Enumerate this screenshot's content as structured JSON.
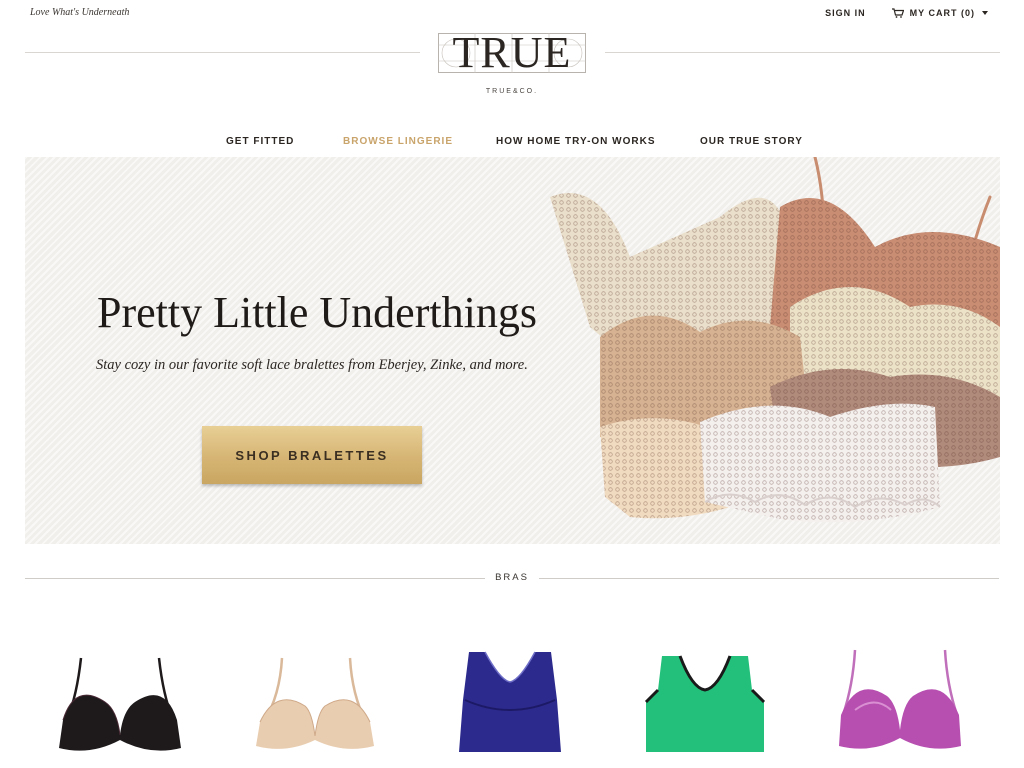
{
  "header": {
    "tagline": "Love What's Underneath",
    "sign_in": "SIGN IN",
    "cart": "MY CART (0)",
    "logo": "TRUE",
    "logo_sub": "TRUE&CO."
  },
  "nav": {
    "items": [
      {
        "label": "GET FITTED"
      },
      {
        "label": "BROWSE LINGERIE",
        "active": true
      },
      {
        "label": "HOW HOME TRY-ON WORKS"
      },
      {
        "label": "OUR TRUE STORY"
      }
    ]
  },
  "hero": {
    "title": "Pretty Little Underthings",
    "subtitle": "Stay cozy in our favorite soft lace bralettes from Eberjey, Zinke, and more.",
    "button": "SHOP BRALETTES"
  },
  "section": {
    "title": "BRAS"
  },
  "products": [
    {
      "color": "#1e1a1c"
    },
    {
      "color": "#e9cdb0"
    },
    {
      "color": "#2c2a8c"
    },
    {
      "color": "#22c07a"
    },
    {
      "color": "#b64fb0"
    }
  ],
  "colors": {
    "accent_gold": "#c9a46b",
    "button_gold": "#d6b574",
    "text_dark": "#2b2622"
  },
  "icons": [
    "cart-icon",
    "chevron-down-icon"
  ]
}
